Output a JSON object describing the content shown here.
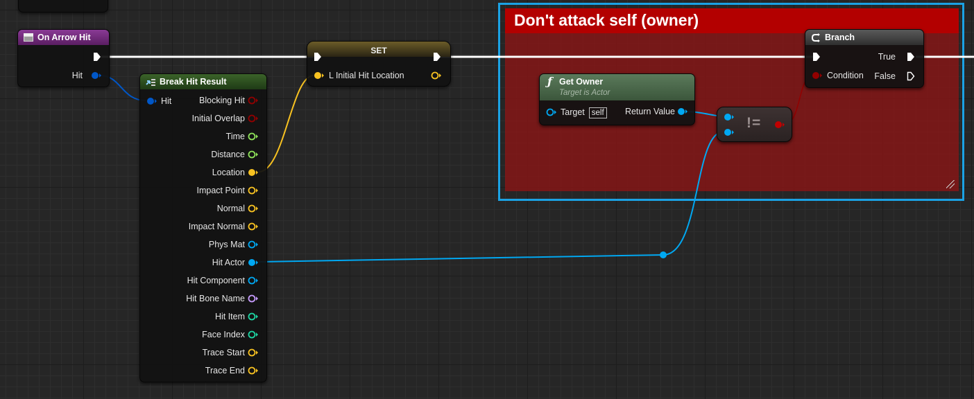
{
  "comment": {
    "title": "Don't attack self (owner)"
  },
  "nodes": {
    "event": {
      "title": "On Arrow Hit",
      "pin_hit": "Hit"
    },
    "break": {
      "title": "Break Hit Result",
      "input": "Hit",
      "outputs": [
        "Blocking Hit",
        "Initial Overlap",
        "Time",
        "Distance",
        "Location",
        "Impact Point",
        "Normal",
        "Impact Normal",
        "Phys Mat",
        "Hit Actor",
        "Hit Component",
        "Hit Bone Name",
        "Hit Item",
        "Face Index",
        "Trace Start",
        "Trace End"
      ]
    },
    "set": {
      "title": "SET",
      "input": "L Initial Hit Location"
    },
    "get_owner": {
      "title": "Get Owner",
      "subtitle": "Target is Actor",
      "target": "Target",
      "target_value": "self",
      "return": "Return Value"
    },
    "notequal": {
      "symbol": "!="
    },
    "branch": {
      "title": "Branch",
      "condition": "Condition",
      "true_label": "True",
      "false_label": "False"
    }
  },
  "colors": {
    "exec": "#ffffff",
    "struct": "#0057c8",
    "object": "#00a8f2",
    "bool": "#930000",
    "float": "#8fe35a",
    "vector": "#f8c221",
    "name": "#c79cff",
    "int": "#1ed6a3",
    "event_header": "#6b2a74",
    "break_header": "#27471c",
    "set_header": "#6b5a20",
    "func_header": "#4c6b4c",
    "branch_header": "#3a3a3a"
  }
}
